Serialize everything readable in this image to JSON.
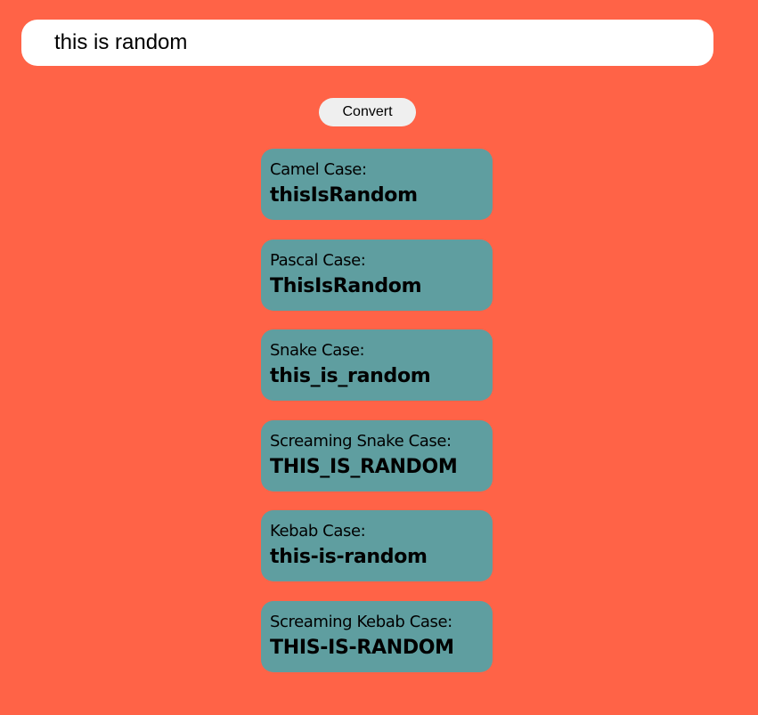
{
  "input": {
    "value": "this is random"
  },
  "convert_button": {
    "label": "Convert"
  },
  "results": [
    {
      "label": "Camel Case:",
      "value": "thisIsRandom"
    },
    {
      "label": "Pascal Case:",
      "value": "ThisIsRandom"
    },
    {
      "label": "Snake Case:",
      "value": "this_is_random"
    },
    {
      "label": "Screaming Snake Case:",
      "value": "THIS_IS_RANDOM"
    },
    {
      "label": "Kebab Case:",
      "value": "this-is-random"
    },
    {
      "label": "Screaming Kebab Case:",
      "value": "THIS-IS-RANDOM"
    }
  ],
  "colors": {
    "background": "#ff6347",
    "card": "#5f9ea0",
    "input_bg": "#ffffff",
    "button_bg": "#efefef"
  }
}
